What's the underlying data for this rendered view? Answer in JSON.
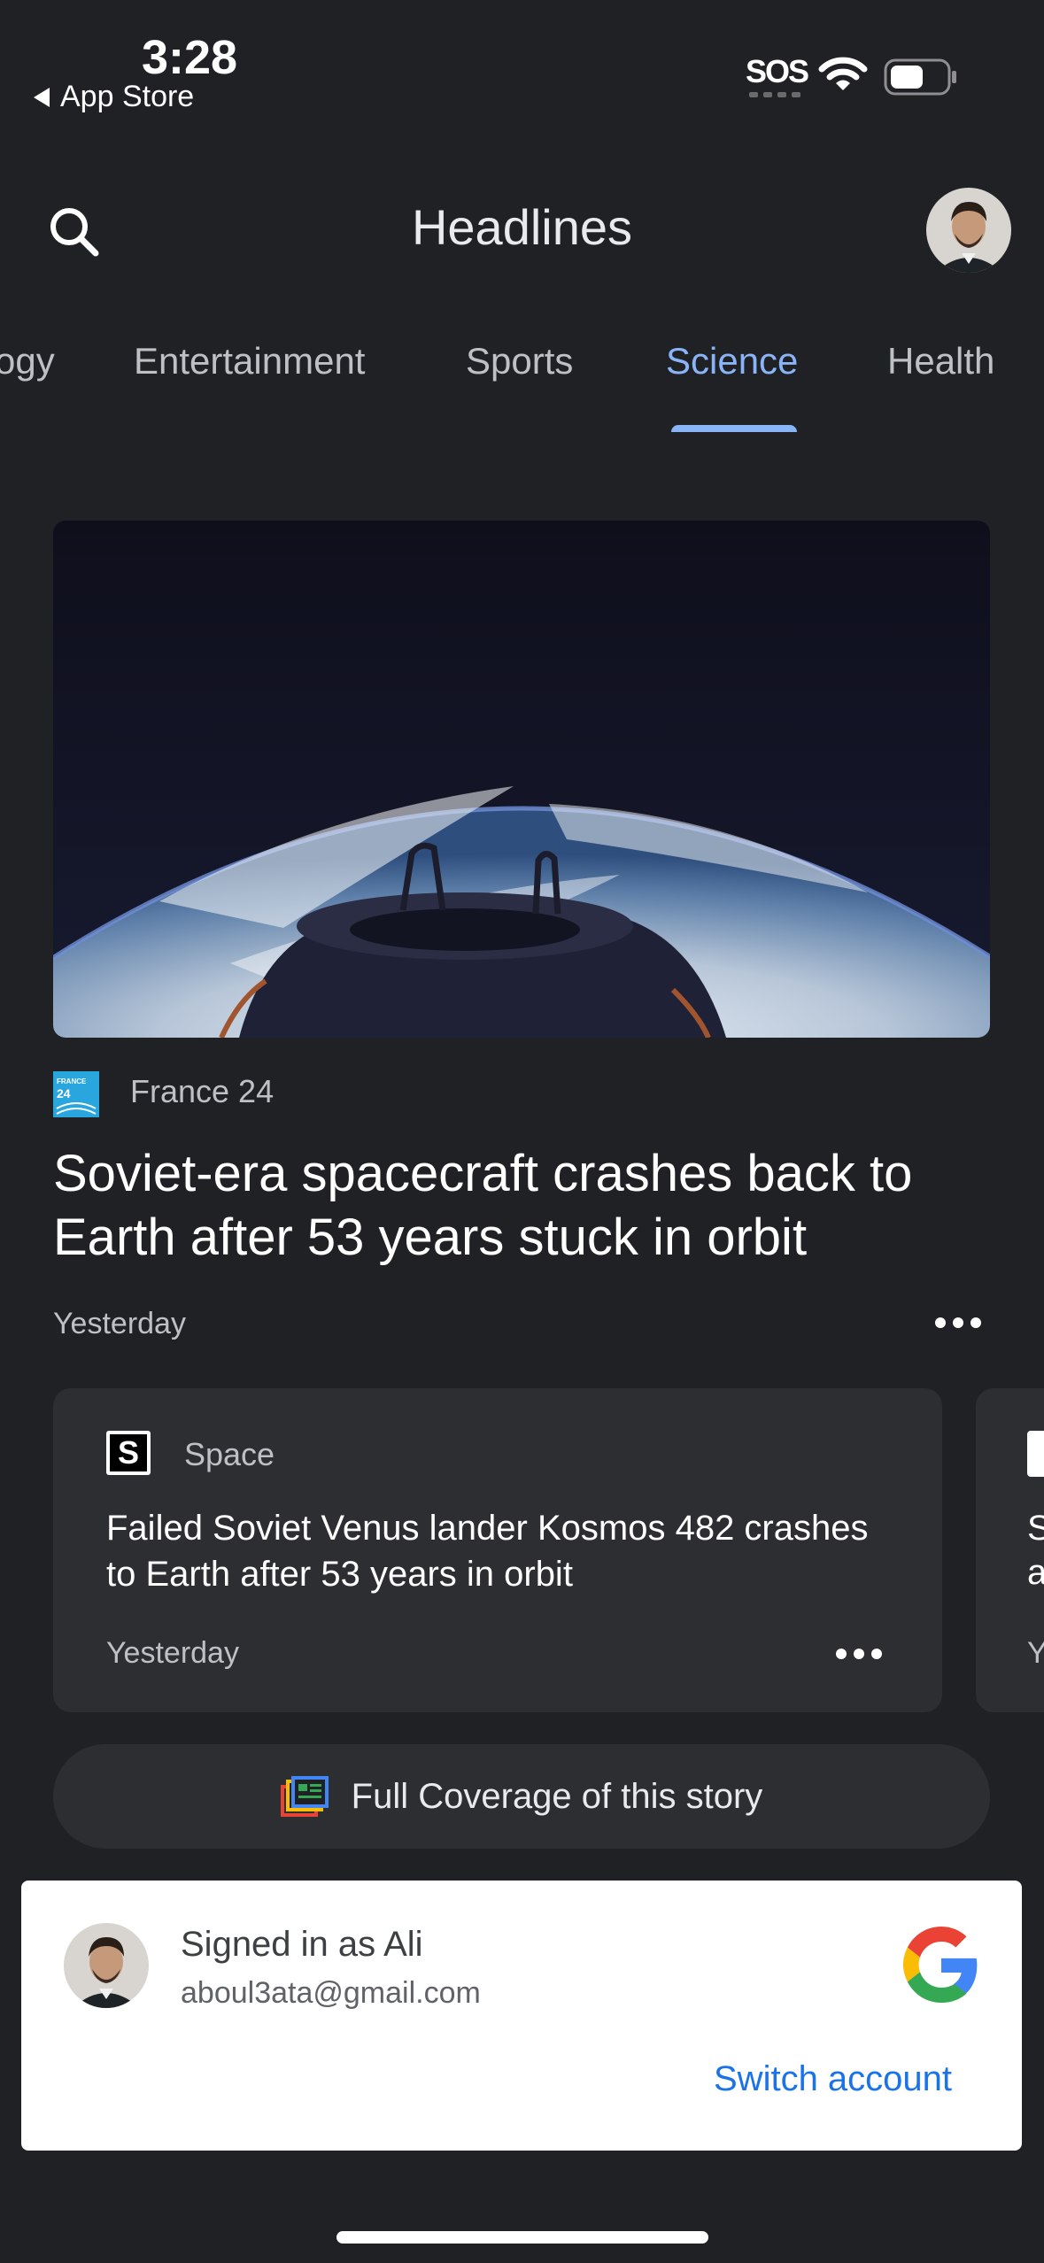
{
  "status_bar": {
    "time": "3:28",
    "back_app": "App Store",
    "sos": "SOS"
  },
  "header": {
    "title": "Headlines"
  },
  "tabs": [
    {
      "label": "ogy"
    },
    {
      "label": "Entertainment"
    },
    {
      "label": "Sports"
    },
    {
      "label": "Science",
      "active": true
    },
    {
      "label": "Health"
    }
  ],
  "hero": {
    "source": "France 24",
    "source_logo_text": "FRANCE 24",
    "headline": "Soviet-era spacecraft crashes back to Earth after 53 years stuck in orbit",
    "time": "Yesterday"
  },
  "related_card": {
    "logo_letter": "S",
    "source": "Space",
    "headline": "Failed Soviet Venus lander Kosmos 482 crashes to Earth after 53 years in orbit",
    "time": "Yesterday"
  },
  "next_card": {
    "line1": "S",
    "line2": "a",
    "time": "Y"
  },
  "full_coverage": {
    "label": "Full Coverage of this story"
  },
  "account": {
    "signed_in": "Signed in as Ali",
    "email": "aboul3ata@gmail.com",
    "switch_label": "Switch account"
  },
  "colors": {
    "background": "#202124",
    "accent": "#8ab4f8",
    "card": "#2d2e31",
    "link_blue": "#1a73e8"
  },
  "icons": [
    "search-icon",
    "avatar",
    "more-icon",
    "full-coverage-icon",
    "google-logo",
    "wifi-icon",
    "battery-icon"
  ]
}
